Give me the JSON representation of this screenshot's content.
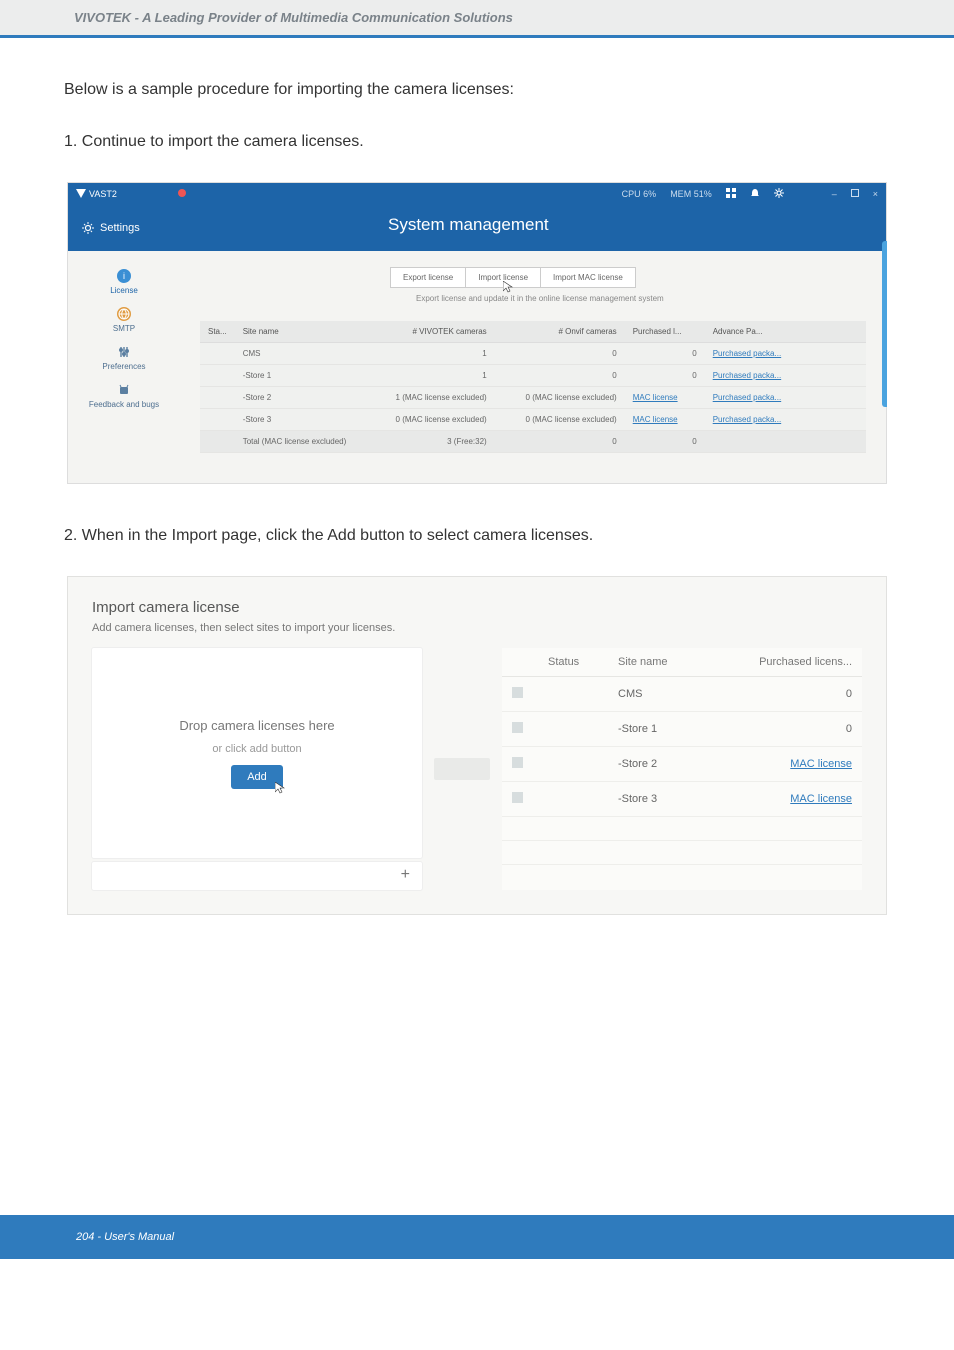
{
  "header": {
    "brand_line": "VIVOTEK - A Leading Provider of Multimedia Communication Solutions"
  },
  "body": {
    "intro": "Below is a sample procedure for importing the camera licenses:",
    "step1": "1. Continue to import the camera licenses.",
    "step2": "2. When in the Import page, click the Add button to select camera licenses."
  },
  "app1": {
    "product": "VAST2",
    "cpu_label": "CPU",
    "cpu_pct": "6%",
    "mem_label": "MEM",
    "mem_pct": "51%",
    "settings": "Settings",
    "page_title": "System management",
    "sidebar": {
      "license": "License",
      "smtp": "SMTP",
      "preferences": "Preferences",
      "feedback": "Feedback and bugs"
    },
    "buttons": {
      "export": "Export license",
      "import": "Import license",
      "import_mac": "Import MAC license"
    },
    "hint": "Export license and update it in the online license management system",
    "table": {
      "cols": {
        "sta": "Sta...",
        "site": "Site name",
        "viv": "# VIVOTEK cameras",
        "onvif": "# Onvif cameras",
        "purch": "Purchased l...",
        "adv": "Advance Pa..."
      },
      "rows": [
        {
          "site": "CMS",
          "viv": "1",
          "onvif": "0",
          "purch": "0",
          "adv": "Purchased packa..."
        },
        {
          "site": "-Store 1",
          "viv": "1",
          "onvif": "0",
          "purch": "0",
          "adv": "Purchased packa..."
        },
        {
          "site": "-Store 2",
          "viv": "1 (MAC license excluded)",
          "onvif": "0 (MAC license excluded)",
          "purch": "MAC license",
          "adv": "Purchased packa..."
        },
        {
          "site": "-Store 3",
          "viv": "0 (MAC license excluded)",
          "onvif": "0 (MAC license excluded)",
          "purch": "MAC license",
          "adv": "Purchased packa..."
        }
      ],
      "total_label": "Total (MAC license excluded)",
      "total_viv": "3 (Free:32)",
      "total_onvif": "0",
      "total_purch": "0"
    }
  },
  "dlg": {
    "title": "Import camera license",
    "subtitle": "Add camera licenses, then select sites to import your licenses.",
    "drop": {
      "line1": "Drop camera licenses here",
      "line2": "or click add button",
      "add": "Add",
      "plus": "+"
    },
    "table": {
      "cols": {
        "status": "Status",
        "site": "Site name",
        "purch": "Purchased licens..."
      },
      "rows": [
        {
          "site": "CMS",
          "purch": "0"
        },
        {
          "site": "-Store 1",
          "purch": "0"
        },
        {
          "site": "-Store 2",
          "purch": "MAC license"
        },
        {
          "site": "-Store 3",
          "purch": "MAC license"
        }
      ]
    }
  },
  "footer": {
    "text": "204 - User's Manual"
  }
}
